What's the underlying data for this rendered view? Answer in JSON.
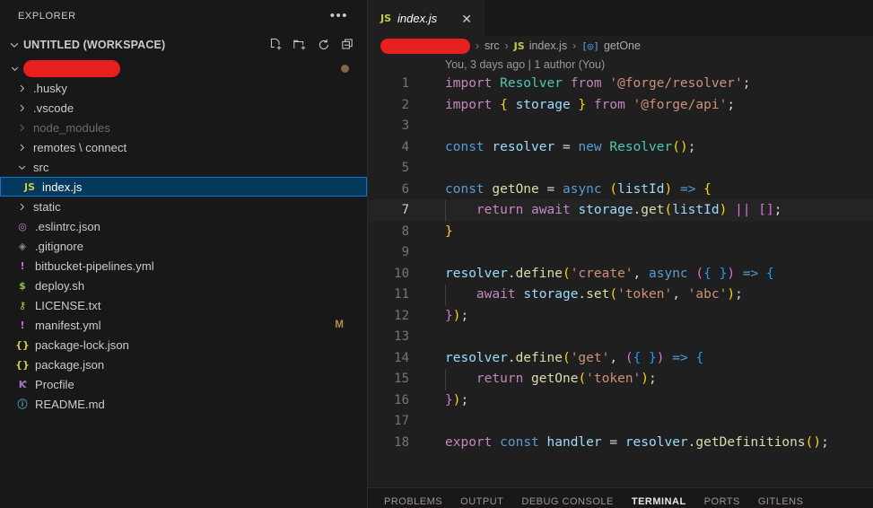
{
  "sidebar": {
    "title": "EXPLORER",
    "more_actions_label": "•••",
    "workspace": {
      "label": "UNTITLED (WORKSPACE)",
      "chevron": "chevron-down-icon",
      "actions": [
        "new-file-icon",
        "new-folder-icon",
        "refresh-icon",
        "collapse-all-icon"
      ]
    },
    "tree": [
      {
        "name": "",
        "type": "folder-redacted",
        "indent": 1,
        "expanded": true,
        "redacted": true,
        "trailing_dot": true
      },
      {
        "name": ".husky",
        "type": "folder",
        "indent": 2,
        "expanded": false
      },
      {
        "name": ".vscode",
        "type": "folder",
        "indent": 2,
        "expanded": false
      },
      {
        "name": "node_modules",
        "type": "folder",
        "indent": 2,
        "expanded": false,
        "dimmed": true
      },
      {
        "name": "remotes \\ connect",
        "type": "folder",
        "indent": 2,
        "expanded": false
      },
      {
        "name": "src",
        "type": "folder",
        "indent": 2,
        "expanded": true
      },
      {
        "name": "index.js",
        "type": "file",
        "icon": "JS",
        "icon_color": "#cbcb41",
        "indent": 3,
        "selected": true
      },
      {
        "name": "static",
        "type": "folder",
        "indent": 2,
        "expanded": false
      },
      {
        "name": ".eslintrc.json",
        "type": "file",
        "icon": "◎",
        "icon_color": "#c586c0",
        "indent": 2
      },
      {
        "name": ".gitignore",
        "type": "file",
        "icon": "◈",
        "icon_color": "#8a8a8a",
        "indent": 2
      },
      {
        "name": "bitbucket-pipelines.yml",
        "type": "file",
        "icon": "!",
        "icon_color": "#cf6bd6",
        "indent": 2
      },
      {
        "name": "deploy.sh",
        "type": "file",
        "icon": "$",
        "icon_color": "#8dc149",
        "indent": 2
      },
      {
        "name": "LICENSE.txt",
        "type": "file",
        "icon": "⚷",
        "icon_color": "#cbcb41",
        "indent": 2
      },
      {
        "name": "manifest.yml",
        "type": "file",
        "icon": "!",
        "icon_color": "#cf6bd6",
        "indent": 2,
        "badge": "M"
      },
      {
        "name": "package-lock.json",
        "type": "file",
        "icon": "{}",
        "icon_color": "#cbcb41",
        "indent": 2
      },
      {
        "name": "package.json",
        "type": "file",
        "icon": "{}",
        "icon_color": "#cbcb41",
        "indent": 2
      },
      {
        "name": "Procfile",
        "type": "file",
        "icon": "Ƙ",
        "icon_color": "#a074c4",
        "indent": 2
      },
      {
        "name": "README.md",
        "type": "file",
        "icon": "ⓘ",
        "icon_color": "#519aba",
        "indent": 2
      }
    ]
  },
  "editor": {
    "tab": {
      "icon": "JS",
      "label": "index.js",
      "close": "✕",
      "preview": true
    },
    "breadcrumb": {
      "redacted_root": true,
      "segments": [
        "src",
        "index.js",
        "getOne"
      ],
      "file_icon": "JS",
      "symbol_icon": "symbol-function-icon",
      "separator": "›"
    },
    "blame": "You, 3 days ago | 1 author (You)",
    "active_line": 7,
    "lines": [
      {
        "n": 1,
        "tokens": [
          [
            "t-kw",
            "import "
          ],
          [
            "t-cls",
            "Resolver"
          ],
          [
            "t-op",
            " "
          ],
          [
            "t-kw",
            "from"
          ],
          [
            "t-op",
            " "
          ],
          [
            "t-str",
            "'@forge/resolver'"
          ],
          [
            "t-op",
            ";"
          ]
        ]
      },
      {
        "n": 2,
        "tokens": [
          [
            "t-kw",
            "import "
          ],
          [
            "t-p1",
            "{"
          ],
          [
            "t-var",
            " storage "
          ],
          [
            "t-p1",
            "}"
          ],
          [
            "t-op",
            " "
          ],
          [
            "t-kw",
            "from"
          ],
          [
            "t-op",
            " "
          ],
          [
            "t-str",
            "'@forge/api'"
          ],
          [
            "t-op",
            ";"
          ]
        ]
      },
      {
        "n": 3,
        "tokens": []
      },
      {
        "n": 4,
        "tokens": [
          [
            "t-ctl",
            "const"
          ],
          [
            "t-op",
            " "
          ],
          [
            "t-var",
            "resolver"
          ],
          [
            "t-op",
            " = "
          ],
          [
            "t-ctl",
            "new"
          ],
          [
            "t-op",
            " "
          ],
          [
            "t-cls",
            "Resolver"
          ],
          [
            "t-p1",
            "()"
          ],
          [
            "t-op",
            ";"
          ]
        ]
      },
      {
        "n": 5,
        "tokens": []
      },
      {
        "n": 6,
        "tokens": [
          [
            "t-ctl",
            "const"
          ],
          [
            "t-op",
            " "
          ],
          [
            "t-fn",
            "getOne"
          ],
          [
            "t-op",
            " = "
          ],
          [
            "t-ctl",
            "async"
          ],
          [
            "t-op",
            " "
          ],
          [
            "t-p1",
            "("
          ],
          [
            "t-var",
            "listId"
          ],
          [
            "t-p1",
            ")"
          ],
          [
            "t-op",
            " "
          ],
          [
            "t-ctl",
            "=>"
          ],
          [
            "t-op",
            " "
          ],
          [
            "t-p1",
            "{"
          ]
        ]
      },
      {
        "n": 7,
        "indent_guide": true,
        "tokens": [
          [
            "t-op",
            "    "
          ],
          [
            "t-kw",
            "return"
          ],
          [
            "t-op",
            " "
          ],
          [
            "t-kw",
            "await"
          ],
          [
            "t-op",
            " "
          ],
          [
            "t-var",
            "storage"
          ],
          [
            "t-op",
            "."
          ],
          [
            "t-fn",
            "get"
          ],
          [
            "t-p1",
            "("
          ],
          [
            "t-var",
            "listId"
          ],
          [
            "t-p1",
            ")"
          ],
          [
            "t-op",
            " "
          ],
          [
            "t-p2",
            "||"
          ],
          [
            "t-op",
            " "
          ],
          [
            "t-p2",
            "[]"
          ],
          [
            "t-op",
            ";"
          ]
        ]
      },
      {
        "n": 8,
        "tokens": [
          [
            "t-p1",
            "}"
          ]
        ]
      },
      {
        "n": 9,
        "tokens": []
      },
      {
        "n": 10,
        "tokens": [
          [
            "t-var",
            "resolver"
          ],
          [
            "t-op",
            "."
          ],
          [
            "t-fn",
            "define"
          ],
          [
            "t-p1",
            "("
          ],
          [
            "t-str",
            "'create'"
          ],
          [
            "t-op",
            ", "
          ],
          [
            "t-ctl",
            "async"
          ],
          [
            "t-op",
            " "
          ],
          [
            "t-p2",
            "("
          ],
          [
            "t-p3",
            "{ }"
          ],
          [
            "t-p2",
            ")"
          ],
          [
            "t-op",
            " "
          ],
          [
            "t-ctl",
            "=>"
          ],
          [
            "t-op",
            " "
          ],
          [
            "t-p3",
            "{"
          ]
        ]
      },
      {
        "n": 11,
        "indent_guide": true,
        "tokens": [
          [
            "t-op",
            "    "
          ],
          [
            "t-kw",
            "await"
          ],
          [
            "t-op",
            " "
          ],
          [
            "t-var",
            "storage"
          ],
          [
            "t-op",
            "."
          ],
          [
            "t-fn",
            "set"
          ],
          [
            "t-p1",
            "("
          ],
          [
            "t-str",
            "'token'"
          ],
          [
            "t-op",
            ", "
          ],
          [
            "t-str",
            "'abc'"
          ],
          [
            "t-p1",
            ")"
          ],
          [
            "t-op",
            ";"
          ]
        ]
      },
      {
        "n": 12,
        "tokens": [
          [
            "t-p2",
            "}"
          ],
          [
            "t-p1",
            ")"
          ],
          [
            "t-op",
            ";"
          ]
        ]
      },
      {
        "n": 13,
        "tokens": []
      },
      {
        "n": 14,
        "tokens": [
          [
            "t-var",
            "resolver"
          ],
          [
            "t-op",
            "."
          ],
          [
            "t-fn",
            "define"
          ],
          [
            "t-p1",
            "("
          ],
          [
            "t-str",
            "'get'"
          ],
          [
            "t-op",
            ", "
          ],
          [
            "t-p2",
            "("
          ],
          [
            "t-p3",
            "{ }"
          ],
          [
            "t-p2",
            ")"
          ],
          [
            "t-op",
            " "
          ],
          [
            "t-ctl",
            "=>"
          ],
          [
            "t-op",
            " "
          ],
          [
            "t-p3",
            "{"
          ]
        ]
      },
      {
        "n": 15,
        "indent_guide": true,
        "tokens": [
          [
            "t-op",
            "    "
          ],
          [
            "t-kw",
            "return"
          ],
          [
            "t-op",
            " "
          ],
          [
            "t-fn",
            "getOne"
          ],
          [
            "t-p1",
            "("
          ],
          [
            "t-str",
            "'token'"
          ],
          [
            "t-p1",
            ")"
          ],
          [
            "t-op",
            ";"
          ]
        ]
      },
      {
        "n": 16,
        "tokens": [
          [
            "t-p2",
            "}"
          ],
          [
            "t-p1",
            ")"
          ],
          [
            "t-op",
            ";"
          ]
        ]
      },
      {
        "n": 17,
        "tokens": []
      },
      {
        "n": 18,
        "tokens": [
          [
            "t-kw",
            "export"
          ],
          [
            "t-op",
            " "
          ],
          [
            "t-ctl",
            "const"
          ],
          [
            "t-op",
            " "
          ],
          [
            "t-var",
            "handler"
          ],
          [
            "t-op",
            " = "
          ],
          [
            "t-var",
            "resolver"
          ],
          [
            "t-op",
            "."
          ],
          [
            "t-fn",
            "getDefinitions"
          ],
          [
            "t-p1",
            "()"
          ],
          [
            "t-op",
            ";"
          ]
        ]
      }
    ]
  },
  "panel": {
    "tabs": [
      {
        "label": "PROBLEMS",
        "active": false
      },
      {
        "label": "OUTPUT",
        "active": false
      },
      {
        "label": "DEBUG CONSOLE",
        "active": false
      },
      {
        "label": "TERMINAL",
        "active": true
      },
      {
        "label": "PORTS",
        "active": false
      },
      {
        "label": "GITLENS",
        "active": false
      }
    ]
  },
  "colors": {
    "sidebar_bg": "#181818",
    "editor_bg": "#1f1f1f",
    "selection_bg": "#04395e",
    "selection_border": "#0078d4",
    "redact": "#e81f1f",
    "accent_js": "#cbcb41"
  }
}
